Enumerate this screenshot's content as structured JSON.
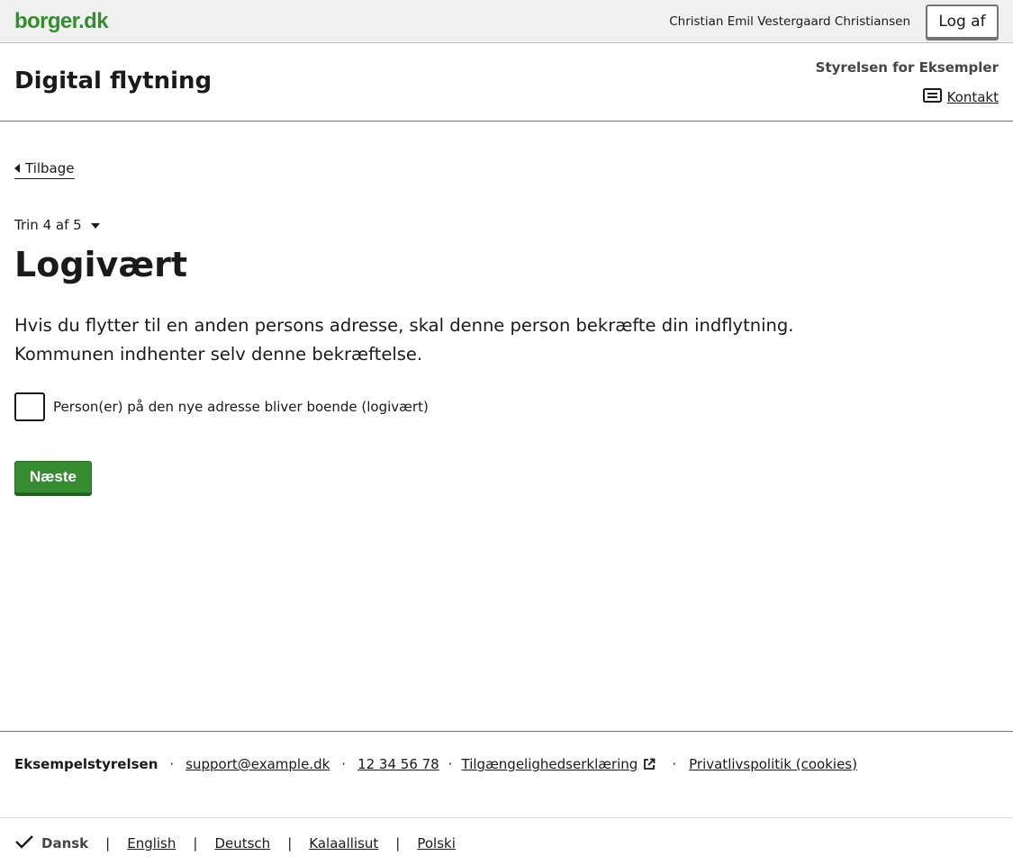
{
  "topbar": {
    "logo": "borger.dk",
    "user_name": "Christian Emil Vestergaard Christiansen",
    "logout_label": "Log af"
  },
  "header": {
    "app_title": "Digital flytning",
    "authority": "Styrelsen for Eksempler",
    "contact_label": "Kontakt",
    "contact_icon": "contact-card-icon"
  },
  "main": {
    "back_label": "Tilbage",
    "step_label": "Trin 4 af 5",
    "title": "Logivært",
    "intro_line1": "Hvis du flytter til en anden persons adresse, skal denne person bekræfte din indflytning.",
    "intro_line2": "Kommunen indhenter selv denne bekræftelse.",
    "checkbox_label": "Person(er) på den nye adresse bliver boende (logivært)",
    "checkbox_checked": false,
    "next_label": "Næste"
  },
  "footer": {
    "org": "Eksempelstyrelsen",
    "email": "support@example.dk",
    "phone": "12 34 56 78",
    "accessibility": "Tilgængelighedserklæring",
    "privacy": "Privatlivspolitik (cookies)",
    "separator": "·",
    "languages": {
      "current": "Dansk",
      "others": [
        "English",
        "Deutsch",
        "Kalaallisut",
        "Polski"
      ],
      "separator": "|"
    }
  },
  "colors": {
    "brand_green": "#358d2f",
    "topbar_bg": "#f0f0f0",
    "text": "#1a1a1a"
  }
}
